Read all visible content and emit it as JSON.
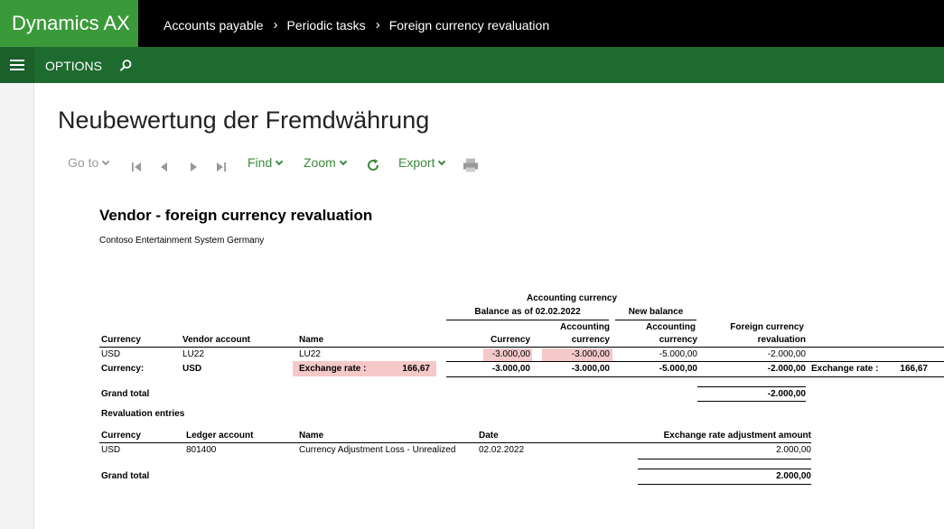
{
  "app": {
    "brand": "Dynamics AX"
  },
  "breadcrumb": [
    "Accounts payable",
    "Periodic tasks",
    "Foreign currency revaluation"
  ],
  "actionbar": {
    "options_label": "OPTIONS"
  },
  "page": {
    "title": "Neubewertung der Fremdwährung"
  },
  "toolbar": {
    "goto": "Go to",
    "find": "Find",
    "zoom": "Zoom",
    "export": "Export"
  },
  "report": {
    "title": "Vendor - foreign currency revaluation",
    "company": "Contoso Entertainment System Germany",
    "group_headers": {
      "accounting_currency": "Accounting currency",
      "balance_as_of": "Balance as of 02.02.2022",
      "new_balance": "New balance"
    },
    "columns": {
      "currency": "Currency",
      "vendor_account": "Vendor account",
      "name": "Name",
      "bal_currency": "Currency",
      "bal_accounting_1": "Accounting",
      "bal_accounting_2": "currency",
      "new_accounting_1": "Accounting",
      "new_accounting_2": "currency",
      "fcr_1": "Foreign currency",
      "fcr_2": "revaluation"
    },
    "row": {
      "currency": "USD",
      "vendor_account": "LU22",
      "name": "LU22",
      "bal_currency": "-3.000,00",
      "bal_accounting": "-3.000,00",
      "new_accounting": "-5.000,00",
      "fcr": "-2.000,00"
    },
    "subtotal": {
      "label": "Currency:",
      "currency": "USD",
      "exchange_rate_label": "Exchange rate :",
      "exchange_rate": "166,67",
      "bal_currency": "-3.000,00",
      "bal_accounting": "-3.000,00",
      "new_accounting": "-5.000,00",
      "fcr": "-2.000,00",
      "exchange_rate_label_2": "Exchange rate :",
      "exchange_rate_2": "166,67"
    },
    "grand_total_1": {
      "label": "Grand total",
      "value": "-2.000,00"
    },
    "revaluation": {
      "heading": "Revaluation entries",
      "columns": {
        "currency": "Currency",
        "ledger_account": "Ledger account",
        "name": "Name",
        "date": "Date",
        "amount": "Exchange rate adjustment amount"
      },
      "row": {
        "currency": "USD",
        "ledger_account": "801400",
        "name": "Currency Adjustment Loss - Unrealized",
        "date": "02.02.2022",
        "amount": "2.000,00"
      }
    },
    "grand_total_2": {
      "label": "Grand total",
      "value": "2.000,00"
    }
  },
  "colors": {
    "brand": "#3a9a3a",
    "actionbar": "#1e6b30",
    "accent_text": "#3a8a3a",
    "highlight": "#f5c9c9"
  }
}
